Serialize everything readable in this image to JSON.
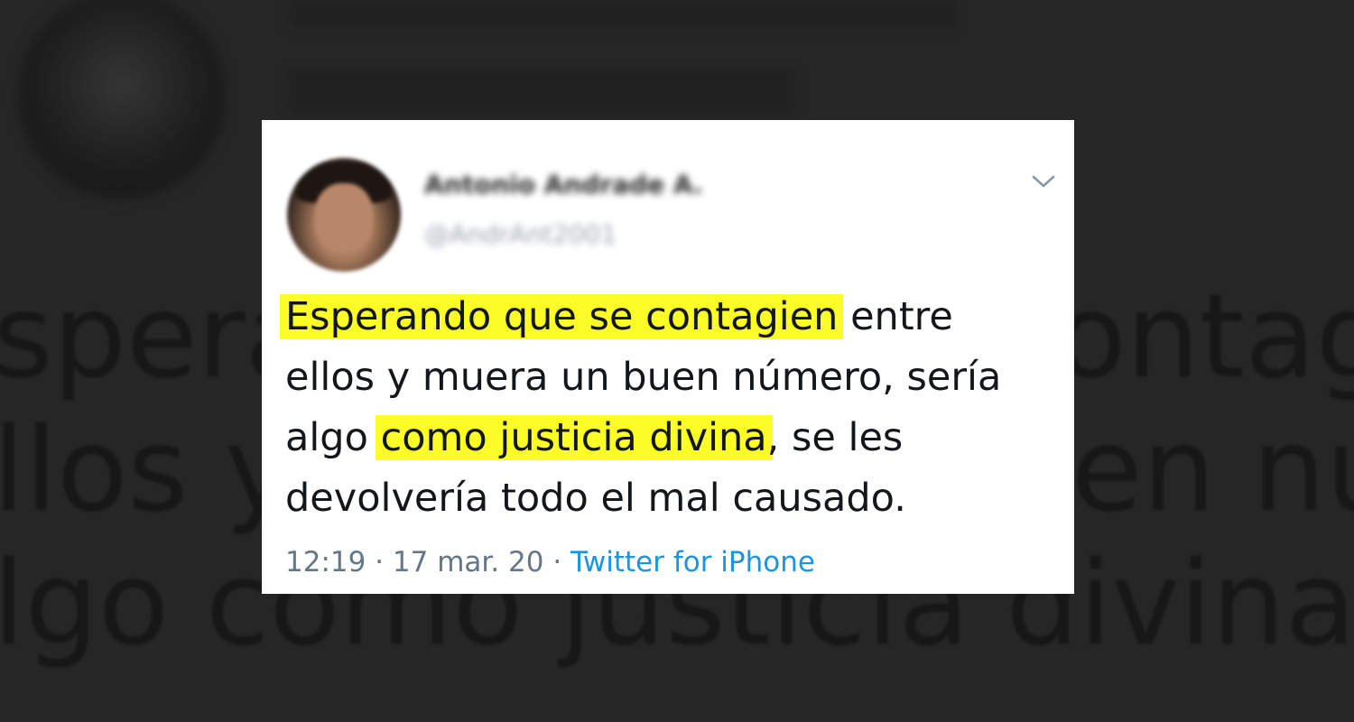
{
  "tweet": {
    "display_name": "Antonio Andrade A.",
    "handle": "@AndrAnt2001",
    "text_parts": [
      {
        "text": "Esperando que se contagien",
        "highlight": true
      },
      {
        "text": " entre ellos y muera un buen número, sería algo ",
        "highlight": false
      },
      {
        "text": "como justicia divina",
        "highlight": true
      },
      {
        "text": ", se les devolvería todo el mal causado.",
        "highlight": false
      }
    ],
    "time": "12:19",
    "separator": "·",
    "date": "17 mar. 20",
    "source": "Twitter for iPhone",
    "menu_icon": "chevron-down-icon",
    "highlight_color": "#fcfc26",
    "link_color": "#1b95e0"
  },
  "background": {
    "text": "sperando que se contagien\nllos y muera un buen número\nlgo como justicia divina, se"
  }
}
